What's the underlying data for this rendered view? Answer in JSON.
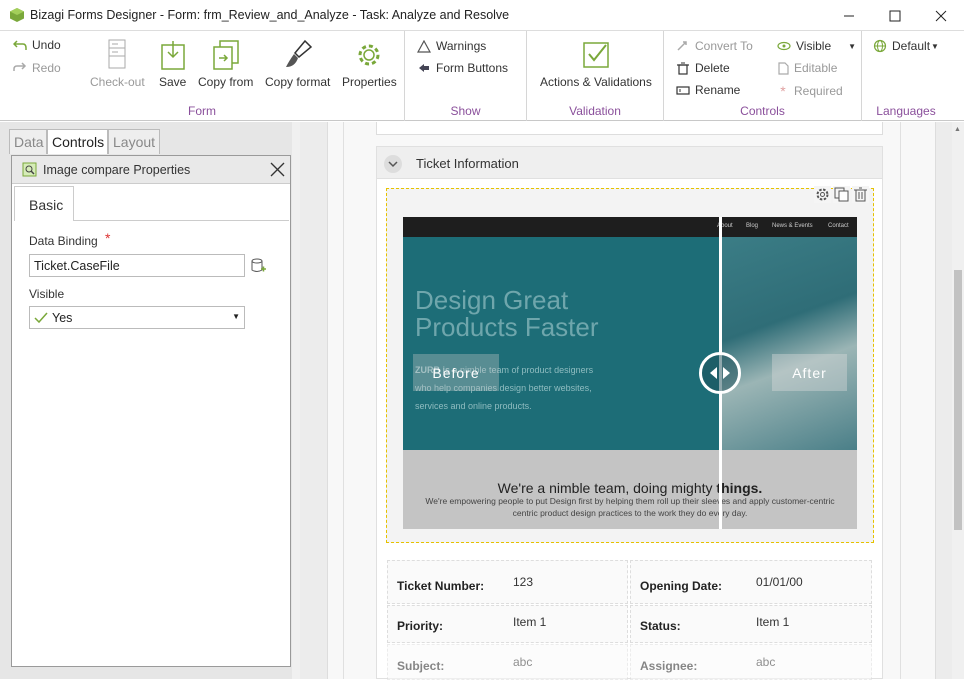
{
  "window": {
    "title": "Bizagi Forms Designer  - Form: frm_Review_and_Analyze - Task:  Analyze and Resolve",
    "minimize_icon": "minimize-icon",
    "maximize_icon": "maximize-icon",
    "close_icon": "close-icon"
  },
  "ribbon": {
    "form_group": {
      "label": "Form",
      "undo": "Undo",
      "redo": "Redo",
      "checkout": "Check-out",
      "save": "Save",
      "copy_from": "Copy from",
      "copy_format": "Copy format",
      "properties": "Properties"
    },
    "show_group": {
      "label": "Show",
      "warnings": "Warnings",
      "form_buttons": "Form Buttons"
    },
    "validation_group": {
      "label": "Validation",
      "actions_validations": "Actions & Validations"
    },
    "controls_group": {
      "label": "Controls",
      "convert_to": "Convert To",
      "delete": "Delete",
      "rename": "Rename",
      "visible": "Visible",
      "editable": "Editable",
      "required": "Required"
    },
    "languages_group": {
      "label": "Languages",
      "default": "Default"
    }
  },
  "left_tabs": {
    "data": "Data",
    "controls": "Controls",
    "layout": "Layout"
  },
  "properties_panel": {
    "title": "Image compare Properties",
    "tab_basic": "Basic",
    "data_binding_label": "Data Binding",
    "required_marker": "*",
    "data_binding_value": "Ticket.CaseFile",
    "visible_label": "Visible",
    "visible_value": "Yes"
  },
  "form": {
    "section_title": "Ticket Information",
    "image_compare": {
      "before_label": "Before",
      "after_label": "After",
      "nav_items": [
        "About",
        "Blog",
        "News & Events",
        "Contact"
      ],
      "headline_line1": "Design Great",
      "headline_line2": "Products Faster",
      "body_text_1": "ZURB is a ",
      "body_text_1b": "nimble team of product designers",
      "body_text_2": "who help companies design better websites,",
      "body_text_3": "services and online products.",
      "tagline_1": "We're a nimble team, doing mighty ",
      "tagline_2": "things.",
      "sub_1": "We're empowering people to put Design first by helping them roll up their sleeves and apply customer-centric",
      "sub_2": "centric product design practices to the work they do every day."
    },
    "fields": [
      {
        "label": "Ticket Number:",
        "value": "123"
      },
      {
        "label": "Opening Date:",
        "value": "01/01/00"
      },
      {
        "label": "Priority:",
        "value": "Item 1"
      },
      {
        "label": "Status:",
        "value": "Item 1"
      },
      {
        "label": "Subject:",
        "value": "abc"
      },
      {
        "label": "Assignee:",
        "value": "abc"
      }
    ]
  },
  "colors": {
    "accent_purple": "#8a4f9b",
    "selection_border": "#e6c200",
    "image_teal": "#1d6d77"
  }
}
